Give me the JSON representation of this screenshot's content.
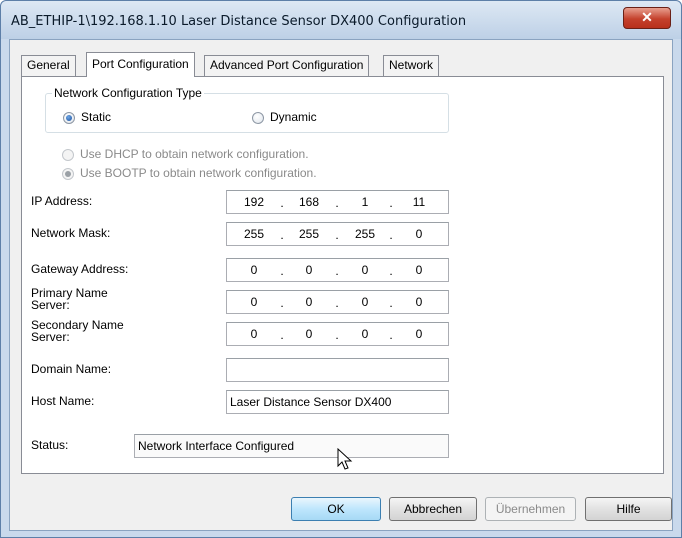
{
  "window": {
    "title": "AB_ETHIP-1\\192.168.1.10 Laser Distance Sensor DX400 Configuration",
    "close_icon": "close-icon"
  },
  "tabs": [
    {
      "label": "General",
      "active": false
    },
    {
      "label": "Port Configuration",
      "active": true
    },
    {
      "label": "Advanced Port Configuration",
      "active": false
    },
    {
      "label": "Network",
      "active": false
    }
  ],
  "config_type": {
    "legend": "Network Configuration Type",
    "static_label": "Static",
    "dynamic_label": "Dynamic",
    "selected": "Static"
  },
  "dhcp_label": "Use DHCP to obtain network configuration.",
  "bootp_label": "Use BOOTP to obtain network configuration.",
  "fields": {
    "ip": {
      "label": "IP Address:",
      "octets": [
        "192",
        "168",
        "1",
        "11"
      ]
    },
    "mask": {
      "label": "Network Mask:",
      "octets": [
        "255",
        "255",
        "255",
        "0"
      ]
    },
    "gateway": {
      "label": "Gateway Address:",
      "octets": [
        "0",
        "0",
        "0",
        "0"
      ]
    },
    "primary": {
      "label_line1": "Primary Name",
      "label_line2": "Server:",
      "octets": [
        "0",
        "0",
        "0",
        "0"
      ]
    },
    "secondary": {
      "label_line1": "Secondary Name",
      "label_line2": "Server:",
      "octets": [
        "0",
        "0",
        "0",
        "0"
      ]
    },
    "domain": {
      "label": "Domain Name:",
      "value": ""
    },
    "host": {
      "label": "Host Name:",
      "value": "Laser Distance Sensor DX400"
    },
    "status": {
      "label": "Status:",
      "value": "Network Interface Configured"
    }
  },
  "separator": ".",
  "buttons": {
    "ok": "OK",
    "cancel": "Abbrechen",
    "apply": "Übernehmen",
    "help": "Hilfe"
  },
  "colors": {
    "accent": "#3c7fb1",
    "close_button": "#c4412c"
  }
}
